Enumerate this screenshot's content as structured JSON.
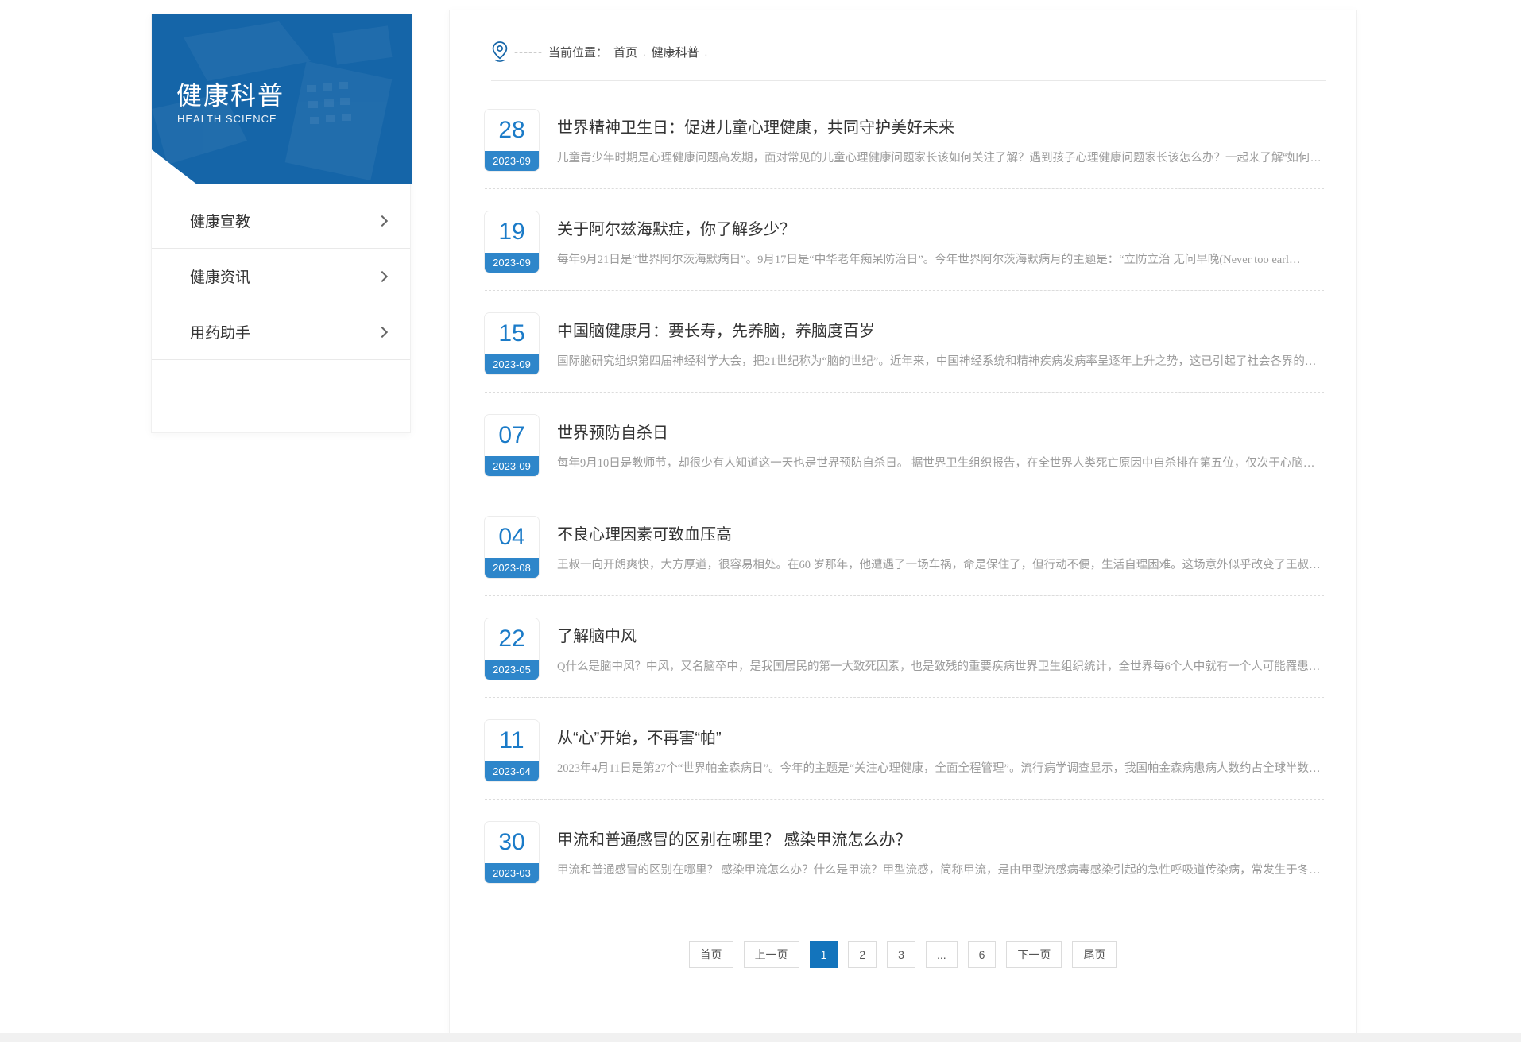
{
  "sidebar": {
    "title": "健康科普",
    "subtitle": "HEALTH SCIENCE",
    "menu": [
      {
        "label": "健康宣教"
      },
      {
        "label": "健康资讯"
      },
      {
        "label": "用药助手"
      }
    ]
  },
  "breadcrumb": {
    "dashes": "------",
    "label": "当前位置：",
    "home": "首页",
    "sep1": ".",
    "current": "健康科普",
    "sep2": "."
  },
  "articles": [
    {
      "day": "28",
      "month": "2023-09",
      "title": "世界精神卫生日：促进儿童心理健康，共同守护美好未来",
      "desc": "儿童青少年时期是心理健康问题高发期，面对常见的儿童心理健康问题家长该如何关注了解？遇到孩子心理健康问题家长该怎么办？一起来了解“如何判断…"
    },
    {
      "day": "19",
      "month": "2023-09",
      "title": "关于阿尔兹海默症，你了解多少？",
      "desc": "每年9月21日是“世界阿尔茨海默病日”。9月17日是“中华老年痴呆防治日”。今年世界阿尔茨海默病月的主题是：“立防立治 无问早晚(Never too earl…"
    },
    {
      "day": "15",
      "month": "2023-09",
      "title": "中国脑健康月：要长寿，先养脑，养脑度百岁",
      "desc": "国际脑研究组织第四届神经科学大会，把21世纪称为“脑的世纪”。近年来，中国神经系统和精神疾病发病率呈逐年上升之势，这已引起了社会各界的广泛…"
    },
    {
      "day": "07",
      "month": "2023-09",
      "title": "世界预防自杀日",
      "desc": "每年9月10日是教师节，却很少有人知道这一天也是世界预防自杀日。 据世界卫生组织报告，在全世界人类死亡原因中自杀排在第五位，仅次于心脑血管疾…"
    },
    {
      "day": "04",
      "month": "2023-08",
      "title": "不良心理因素可致血压高",
      "desc": "王叔一向开朗爽快，大方厚道，很容易相处。在60 岁那年，他遭遇了一场车祸，命是保住了，但行动不便，生活自理困难。这场意外似乎改变了王叔的性…"
    },
    {
      "day": "22",
      "month": "2023-05",
      "title": "了解脑中风",
      "desc": "Q什么是脑中风？中风，又名脑卒中，是我国居民的第一大致死因素，也是致残的重要疾病世界卫生组织统计，全世界每6个人中就有一个人可能罹患脑卒中…"
    },
    {
      "day": "11",
      "month": "2023-04",
      "title": "从“心”开始，不再害“帕”",
      "desc": "2023年4月11日是第27个“世界帕金森病日”。今年的主题是“关注心理健康，全面全程管理”。流行病学调查显示，我国帕金森病患病人数约占全球半数…"
    },
    {
      "day": "30",
      "month": "2023-03",
      "title": "甲流和普通感冒的区别在哪里？ 感染甲流怎么办？",
      "desc": "甲流和普通感冒的区别在哪里？ 感染甲流怎么办？什么是甲流？甲型流感，简称甲流，是由甲型流感病毒感染引起的急性呼吸道传染病，常发生于冬春季…"
    }
  ],
  "pagination": [
    {
      "label": "首页"
    },
    {
      "label": "上一页"
    },
    {
      "label": "1",
      "active": true
    },
    {
      "label": "2"
    },
    {
      "label": "3"
    },
    {
      "label": "..."
    },
    {
      "label": "6"
    },
    {
      "label": "下一页"
    },
    {
      "label": "尾页"
    }
  ],
  "colors": {
    "banner_blue": "#1565a8",
    "date_number_blue": "#1b7bc8",
    "date_bar_blue": "#2e86ca",
    "pagination_active_blue": "#1374bc"
  }
}
